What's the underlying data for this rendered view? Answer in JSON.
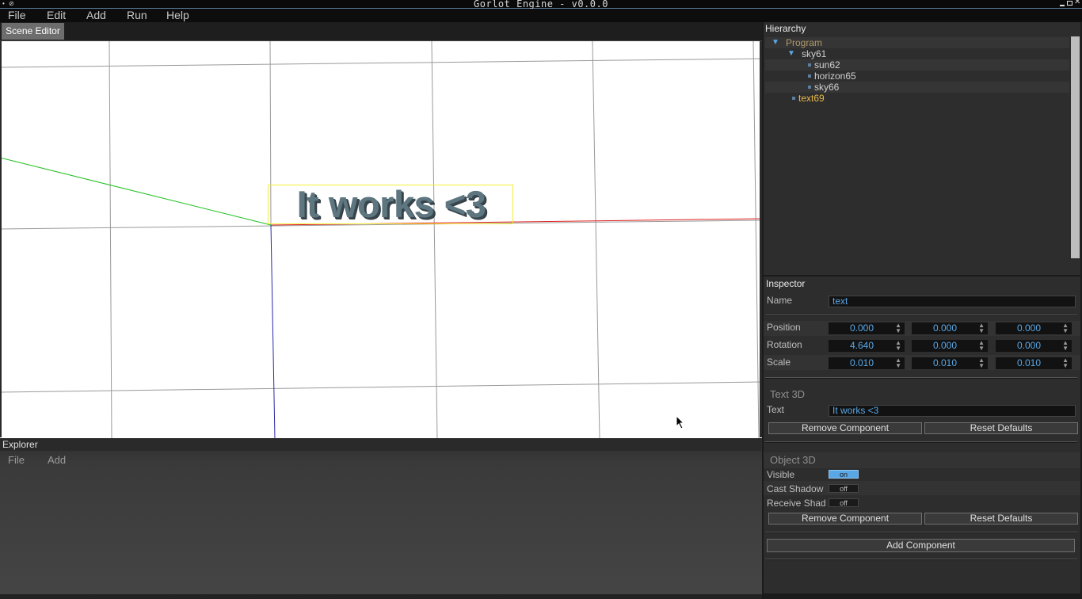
{
  "window": {
    "title": "Gorlot Engine - v0.0.0"
  },
  "menubar": {
    "items": [
      "File",
      "Edit",
      "Add",
      "Run",
      "Help"
    ]
  },
  "scene_editor": {
    "tab_label": "Scene Editor",
    "text_object": "It works <3"
  },
  "explorer": {
    "title": "Explorer",
    "menu": [
      "File",
      "Add"
    ]
  },
  "hierarchy": {
    "title": "Hierarchy",
    "items": [
      {
        "label": "Program",
        "arrow": "▼",
        "color": "#b39a6a"
      },
      {
        "label": "sky61",
        "arrow": "▼",
        "color": "#cfcfcf"
      },
      {
        "label": "sun62",
        "arrow": "",
        "color": "#cfcfcf"
      },
      {
        "label": "horizon65",
        "arrow": "",
        "color": "#cfcfcf"
      },
      {
        "label": "sky66",
        "arrow": "",
        "color": "#cfcfcf"
      },
      {
        "label": "text69",
        "arrow": "",
        "color": "#e9b84a"
      }
    ]
  },
  "inspector": {
    "title": "Inspector",
    "name_label": "Name",
    "name_value": "text",
    "position": {
      "label": "Position",
      "values": [
        "0.000",
        "0.000",
        "0.000"
      ]
    },
    "rotation": {
      "label": "Rotation",
      "values": [
        "4.640",
        "0.000",
        "0.000"
      ]
    },
    "scale": {
      "label": "Scale",
      "values": [
        "0.010",
        "0.010",
        "0.010"
      ]
    },
    "text3d": {
      "title": "Text 3D",
      "text_label": "Text",
      "text_value": "It works <3",
      "remove_label": "Remove Component",
      "reset_label": "Reset Defaults"
    },
    "object3d": {
      "title": "Object 3D",
      "visible_label": "Visible",
      "visible_value": "on",
      "cast_shadow_label": "Cast Shadow",
      "cast_shadow_value": "off",
      "receive_shadow_label": "Receive Shadow",
      "receive_shadow_value": "off",
      "remove_label": "Remove Component",
      "reset_label": "Reset Defaults"
    },
    "add_component_label": "Add Component"
  },
  "colors": {
    "accent": "#5aa7e6",
    "selection": "#f4ee3a",
    "x_axis": "#e02020",
    "z_axis": "#20c020",
    "y_axis": "#2020a0"
  }
}
